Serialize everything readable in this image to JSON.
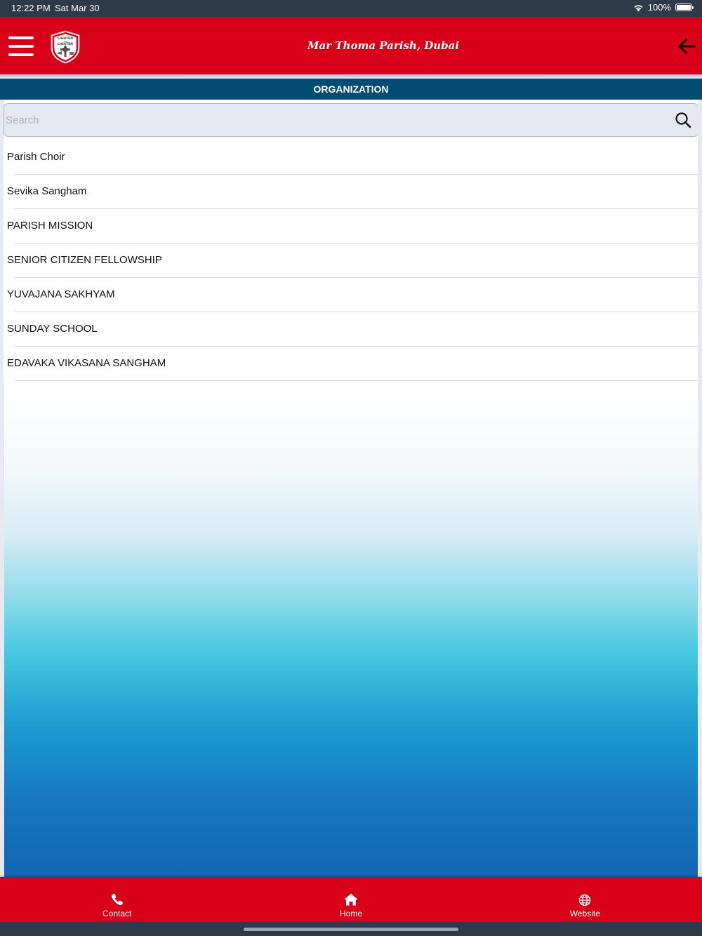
{
  "status_bar": {
    "time": "12:22 PM",
    "date": "Sat Mar 30",
    "battery": "100%",
    "wifi_icon": "wifi-icon"
  },
  "header": {
    "title": "Mar Thoma Parish, Dubai",
    "menu_icon": "hamburger-menu-icon",
    "logo_text_top": "LIGHTED",
    "logo_text_mid": "TO",
    "logo_text_bottom": "LIGHTEN",
    "back_icon": "arrow-left-icon",
    "color": "#d80018"
  },
  "section": {
    "title": "ORGANIZATION",
    "color": "#004c73"
  },
  "search": {
    "placeholder": "Search",
    "value": "",
    "icon": "search-icon"
  },
  "organizations": [
    {
      "label": "Parish Choir"
    },
    {
      "label": "Sevika Sangham"
    },
    {
      "label": "PARISH MISSION"
    },
    {
      "label": "SENIOR CITIZEN FELLOWSHIP"
    },
    {
      "label": "YUVAJANA SAKHYAM"
    },
    {
      "label": "SUNDAY SCHOOL"
    },
    {
      "label": "EDAVAKA VIKASANA SANGHAM"
    }
  ],
  "tab_bar": {
    "tabs": [
      {
        "label": "Contact",
        "icon": "phone-icon"
      },
      {
        "label": "Home",
        "icon": "home-icon"
      },
      {
        "label": "Website",
        "icon": "globe-icon"
      }
    ]
  }
}
